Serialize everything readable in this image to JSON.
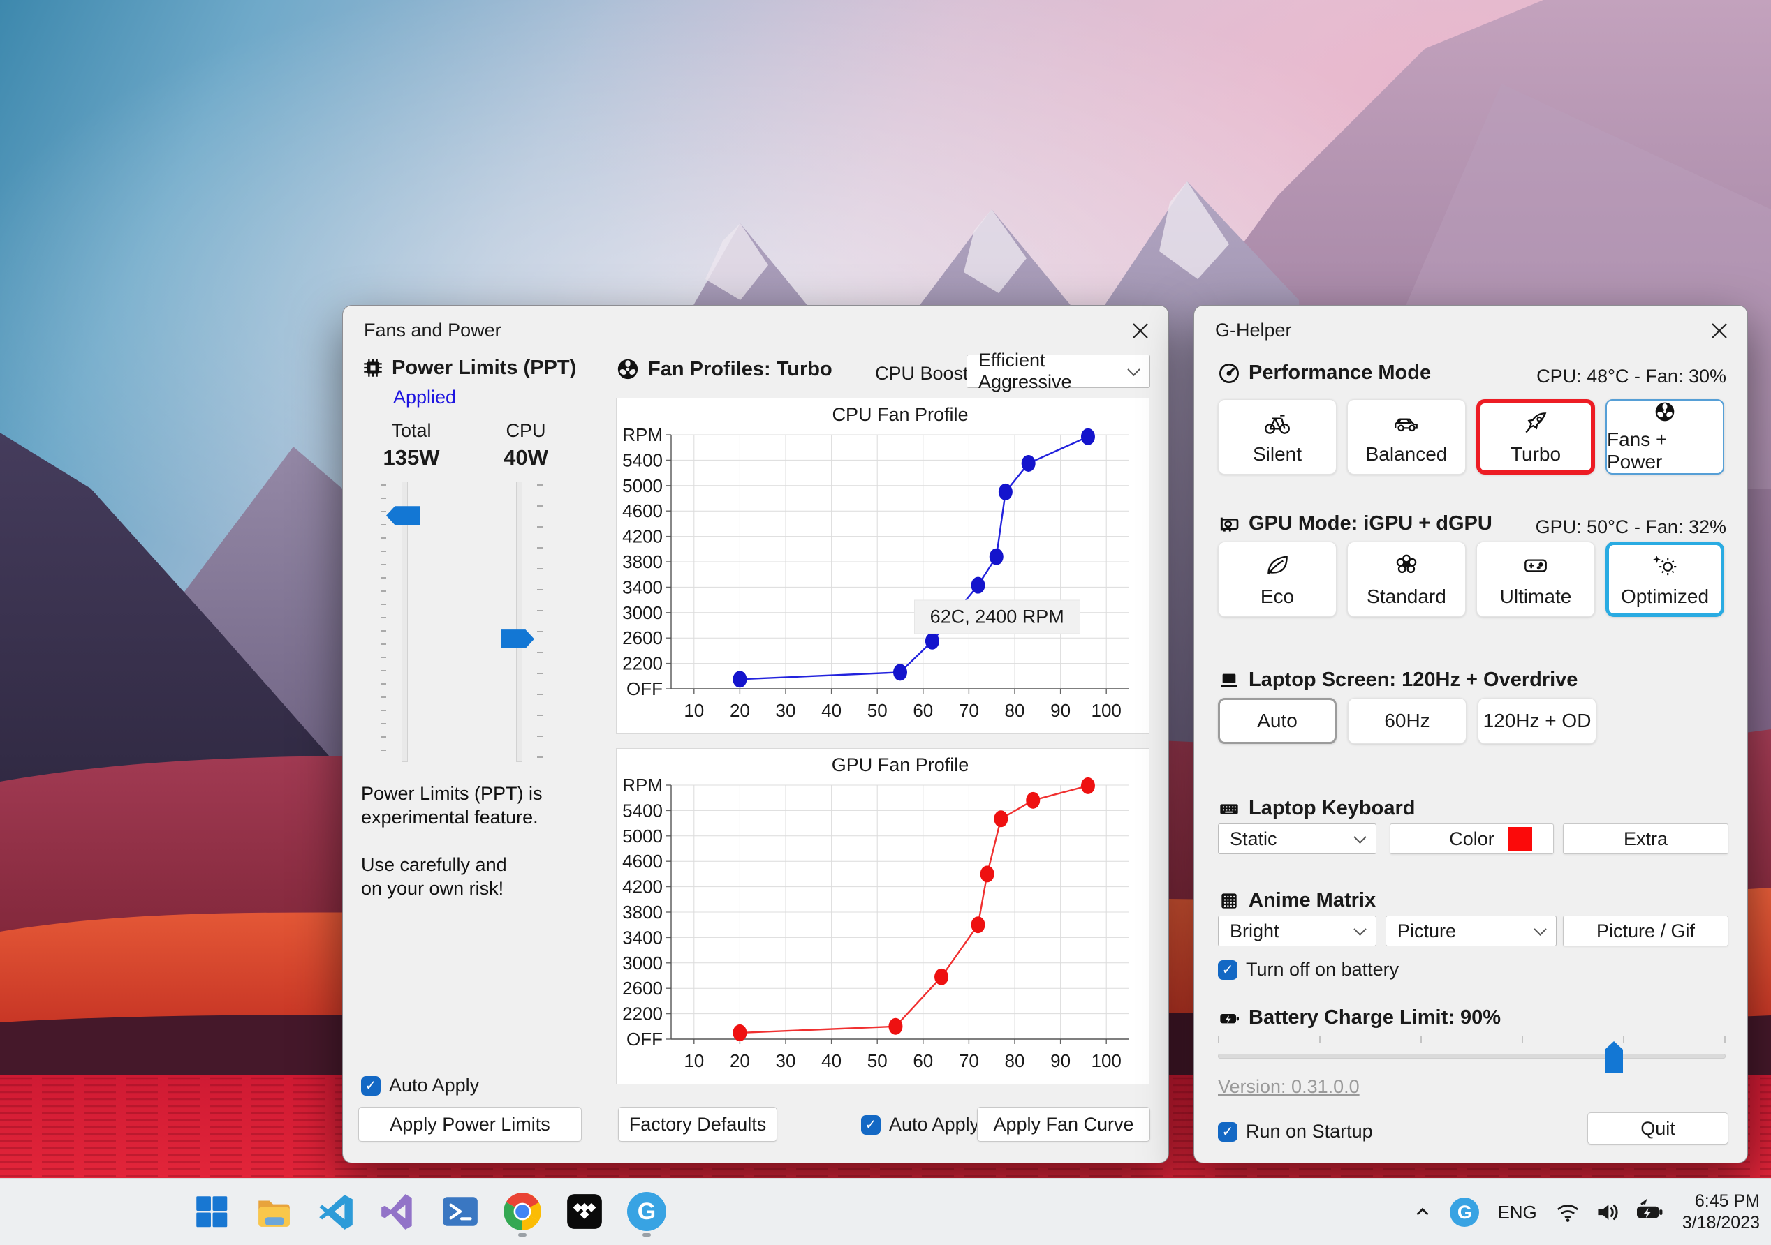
{
  "colors": {
    "accent_blue": "#1368c4",
    "slider_blue": "#1377d4",
    "turbo_border_red": "#ed1c24",
    "optimized_border_blue": "#29abe2",
    "applied_text_blue": "#1d14e0",
    "keyboard_color_swatch": "#fb0a0a",
    "window_bg": "#f0f0f0",
    "taskbar_bg": "#edeff1"
  },
  "fans_window": {
    "title": "Fans and Power",
    "power_limits": {
      "header": "Power Limits (PPT)",
      "status": "Applied",
      "total_label": "Total",
      "total_value": "135W",
      "cpu_label": "CPU",
      "cpu_value": "40W",
      "total_slider_percent": 12,
      "cpu_slider_percent": 56,
      "warning_lines": [
        "Power Limits (PPT) is",
        "experimental feature.",
        "Use carefully and",
        "on your own risk!"
      ],
      "auto_apply_label": "Auto Apply"
    },
    "fan_profiles": {
      "header": "Fan Profiles: Turbo",
      "cpu_boost_label": "CPU Boost",
      "cpu_boost_value": "Efficient Aggressive"
    },
    "footer": {
      "apply_power_limits": "Apply Power Limits",
      "factory_defaults": "Factory Defaults",
      "auto_apply_label": "Auto Apply",
      "apply_fan_curve": "Apply Fan Curve"
    }
  },
  "chart_data": [
    {
      "type": "line",
      "title": "CPU Fan Profile",
      "xlabel": "",
      "ylabel": "RPM",
      "x_ticks": [
        10,
        20,
        30,
        40,
        50,
        60,
        70,
        80,
        90,
        100
      ],
      "y_tick_labels": [
        "OFF",
        "2200",
        "2600",
        "3000",
        "3400",
        "3800",
        "4200",
        "4600",
        "5000",
        "5400",
        "RPM"
      ],
      "y_tick_values": [
        1800,
        2200,
        2600,
        3000,
        3400,
        3800,
        4200,
        4600,
        5000,
        5400,
        5800
      ],
      "xlim": [
        5,
        105
      ],
      "ylim": [
        1800,
        5800
      ],
      "grid": true,
      "line_color": "#2222dd",
      "dot_color": "#1414cc",
      "points": [
        [
          20,
          1950
        ],
        [
          55,
          2060
        ],
        [
          62,
          2550
        ],
        [
          72,
          3430
        ],
        [
          76,
          3880
        ],
        [
          78,
          4900
        ],
        [
          83,
          5350
        ],
        [
          96,
          5770
        ]
      ],
      "annotation": {
        "text": "62C, 2400 RPM",
        "x": 58,
        "y": 2930
      }
    },
    {
      "type": "line",
      "title": "GPU Fan Profile",
      "xlabel": "",
      "ylabel": "RPM",
      "x_ticks": [
        10,
        20,
        30,
        40,
        50,
        60,
        70,
        80,
        90,
        100
      ],
      "y_tick_labels": [
        "OFF",
        "2200",
        "2600",
        "3000",
        "3400",
        "3800",
        "4200",
        "4600",
        "5000",
        "5400",
        "RPM"
      ],
      "y_tick_values": [
        1800,
        2200,
        2600,
        3000,
        3400,
        3800,
        4200,
        4600,
        5000,
        5400,
        5800
      ],
      "xlim": [
        5,
        105
      ],
      "ylim": [
        1800,
        5800
      ],
      "grid": true,
      "line_color": "#f03030",
      "dot_color": "#ee1111",
      "points": [
        [
          20,
          1900
        ],
        [
          54,
          2000
        ],
        [
          64,
          2780
        ],
        [
          72,
          3600
        ],
        [
          74,
          4400
        ],
        [
          77,
          5270
        ],
        [
          84,
          5560
        ],
        [
          96,
          5790
        ]
      ]
    }
  ],
  "ghelper_window": {
    "title": "G-Helper",
    "performance": {
      "header": "Performance Mode",
      "status": "CPU: 48°C  -  Fan: 30%",
      "buttons": [
        {
          "label": "Silent",
          "icon": "bicycle-icon"
        },
        {
          "label": "Balanced",
          "icon": "car-icon"
        },
        {
          "label": "Turbo",
          "icon": "rocket-icon",
          "state": "active-red"
        },
        {
          "label": "Fans + Power",
          "icon": "fan-icon",
          "state": "outline-blue"
        }
      ]
    },
    "gpu": {
      "header": "GPU Mode: iGPU + dGPU",
      "status": "GPU: 50°C  -  Fan: 32%",
      "buttons": [
        {
          "label": "Eco",
          "icon": "leaf-icon"
        },
        {
          "label": "Standard",
          "icon": "flower-icon"
        },
        {
          "label": "Ultimate",
          "icon": "gamepad-icon"
        },
        {
          "label": "Optimized",
          "icon": "optimized-icon",
          "state": "selected-blue"
        }
      ]
    },
    "screen": {
      "header": "Laptop Screen: 120Hz + Overdrive",
      "buttons": [
        {
          "label": "Auto",
          "state": "selected-gray"
        },
        {
          "label": "60Hz"
        },
        {
          "label": "120Hz + OD"
        }
      ]
    },
    "keyboard": {
      "header": "Laptop Keyboard",
      "mode_value": "Static",
      "color_label": "Color",
      "extra_label": "Extra"
    },
    "matrix": {
      "header": "Anime Matrix",
      "brightness_value": "Bright",
      "content_value": "Picture",
      "picture_gif_label": "Picture / Gif",
      "battery_checkbox_label": "Turn off on battery"
    },
    "battery": {
      "header": "Battery Charge Limit: 90%",
      "slider_percent": 78
    },
    "version_link": "Version: 0.31.0.0",
    "run_on_startup_label": "Run on Startup",
    "quit_label": "Quit"
  },
  "taskbar": {
    "icon_names": [
      "start-icon",
      "file-explorer-icon",
      "vscode-icon",
      "visual-studio-icon",
      "powershell-icon",
      "chrome-icon",
      "tidal-icon",
      "ghelper-icon"
    ],
    "tray": {
      "language": "ENG",
      "time": "6:45 PM",
      "date": "3/18/2023"
    }
  }
}
